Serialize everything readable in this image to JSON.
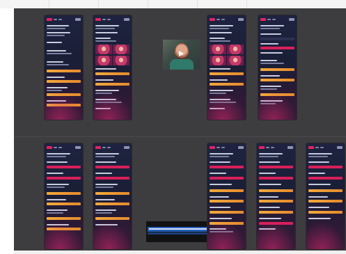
{
  "row_labels": {
    "group_one": "",
    "group_two": ""
  },
  "frames": [
    {
      "name": "phone-frame-1",
      "variant": "list"
    },
    {
      "name": "phone-frame-2",
      "variant": "grid"
    },
    {
      "name": "phone-frame-3",
      "variant": "grid"
    },
    {
      "name": "phone-frame-4",
      "variant": "list"
    },
    {
      "name": "phone-frame-5",
      "variant": "list"
    },
    {
      "name": "phone-frame-6",
      "variant": "list"
    },
    {
      "name": "phone-frame-7",
      "variant": "list"
    },
    {
      "name": "phone-frame-8",
      "variant": "list"
    },
    {
      "name": "phone-frame-9",
      "variant": "list"
    },
    {
      "name": "phone-frame-10",
      "variant": "list"
    }
  ],
  "video_thumbnail": {
    "icon": "play-icon"
  },
  "colors": {
    "canvas": "#3d3d3f",
    "accent_pink": "#d81f5a",
    "accent_orange": "#f2a93b",
    "banner_blue": "#2860b8"
  }
}
